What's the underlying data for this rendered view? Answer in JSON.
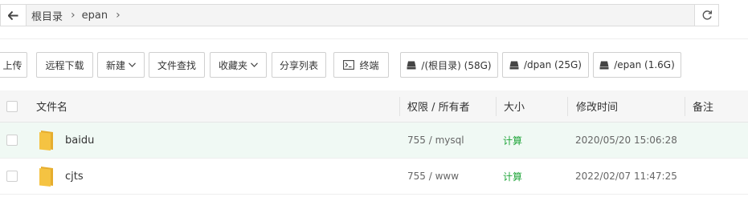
{
  "pathbar": {
    "back_icon": "arrow-left-icon",
    "crumbs": [
      "根目录",
      "epan"
    ],
    "refresh_icon": "refresh-icon"
  },
  "toolbar": {
    "upload": "上传",
    "remote_download": "远程下载",
    "new": "新建",
    "file_search": "文件查找",
    "favorites": "收藏夹",
    "share_list": "分享列表",
    "terminal": "终端",
    "disks": [
      "/(根目录) (58G)",
      "/dpan (25G)",
      "/epan (1.6G)"
    ]
  },
  "table": {
    "headers": {
      "name": "文件名",
      "perm": "权限 / 所有者",
      "size": "大小",
      "mtime": "修改时间",
      "note": "备注"
    },
    "rows": [
      {
        "name": "baidu",
        "perm": "755 / mysql",
        "size": "计算",
        "mtime": "2020/05/20 15:06:28",
        "note": ""
      },
      {
        "name": "cjts",
        "perm": "755 / www",
        "size": "计算",
        "mtime": "2022/02/07 11:47:25",
        "note": ""
      }
    ]
  },
  "colors": {
    "accent_green": "#20a53a",
    "row_highlight": "#f0f9f4",
    "folder": "#f5c342"
  }
}
